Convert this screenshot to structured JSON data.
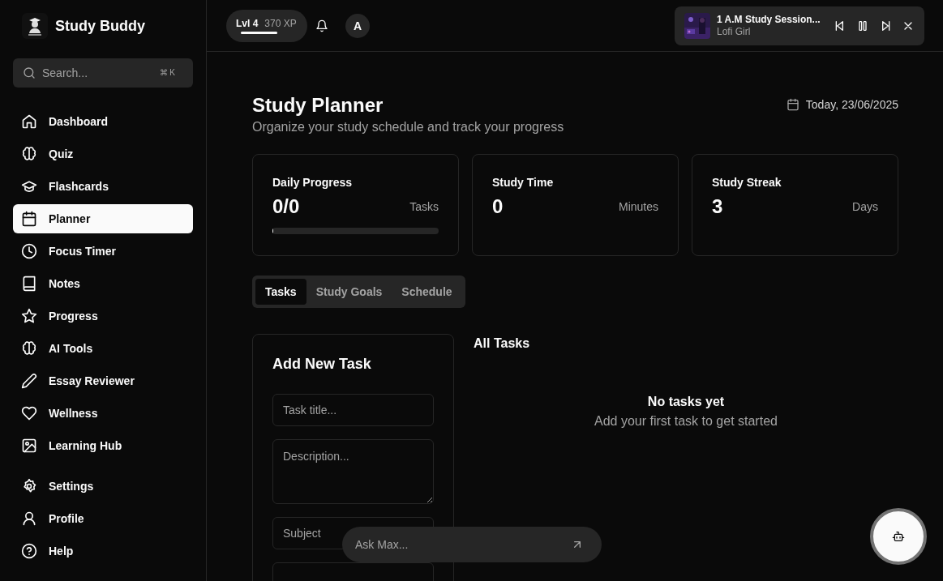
{
  "sidebar": {
    "app_name": "Study Buddy",
    "search": {
      "placeholder": "Search...",
      "shortcut": "⌘ K"
    },
    "items": [
      {
        "label": "Dashboard",
        "selected": false
      },
      {
        "label": "Quiz",
        "selected": false
      },
      {
        "label": "Flashcards",
        "selected": false
      },
      {
        "label": "Planner",
        "selected": true
      },
      {
        "label": "Focus Timer",
        "selected": false
      },
      {
        "label": "Notes",
        "selected": false
      },
      {
        "label": "Progress",
        "selected": false
      },
      {
        "label": "AI Tools",
        "selected": false
      },
      {
        "label": "Essay Reviewer",
        "selected": false
      },
      {
        "label": "Wellness",
        "selected": false
      },
      {
        "label": "Learning Hub",
        "selected": false
      }
    ],
    "footer_items": [
      {
        "label": "Settings",
        "selected": false
      },
      {
        "label": "Profile",
        "selected": false
      },
      {
        "label": "Help",
        "selected": false
      }
    ]
  },
  "topbar": {
    "level": {
      "label": "Lvl 4",
      "xp": "370 XP",
      "level": 1
    },
    "avatar": "A",
    "player": {
      "title": "1 A.M Study Session...",
      "artist": "Lofi Girl"
    }
  },
  "page": {
    "title": "Study Planner",
    "subtitle": "Organize your study schedule and track your progress",
    "date": "Today, 23/06/2025"
  },
  "stats": [
    {
      "title": "Daily Progress",
      "value": "0/0",
      "unit": "Tasks",
      "level": 0
    },
    {
      "title": "Study Time",
      "value": "0",
      "unit": "Minutes"
    },
    {
      "title": "Study Streak",
      "value": "3",
      "unit": "Days"
    }
  ],
  "tabs": [
    {
      "label": "Tasks",
      "selected": true
    },
    {
      "label": "Study Goals",
      "selected": false
    },
    {
      "label": "Schedule",
      "selected": false
    }
  ],
  "add_task": {
    "title": "Add New Task",
    "task_title": {
      "placeholder": "Task title..."
    },
    "description": {
      "placeholder": "Description..."
    },
    "subject": {
      "placeholder": "Subject"
    }
  },
  "all_tasks": {
    "title": "All Tasks",
    "empty_title": "No tasks yet",
    "empty_text": "Add your first task to get started"
  },
  "assistant": {
    "placeholder": "Ask Max..."
  }
}
